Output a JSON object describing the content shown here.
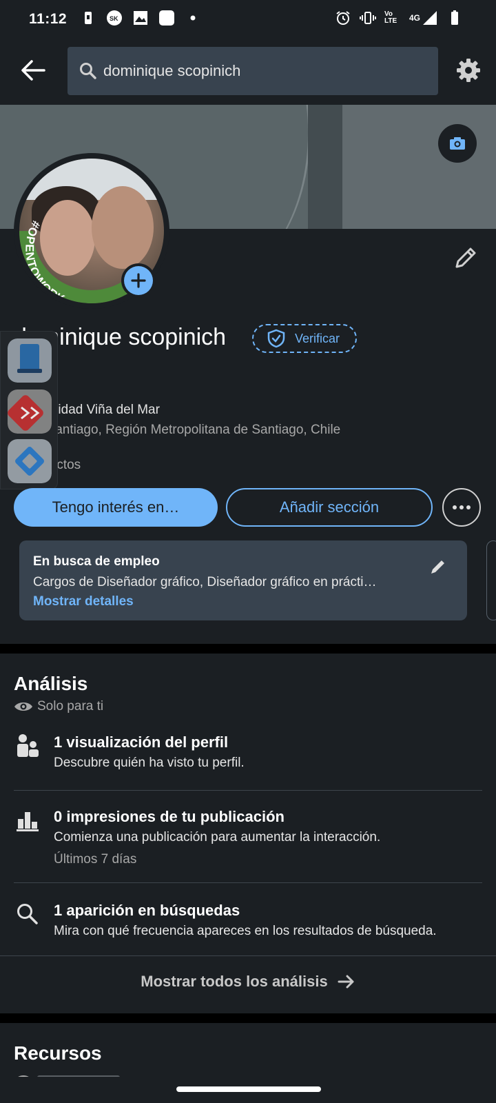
{
  "status_bar": {
    "time": "11:12",
    "network_label": "4G",
    "volte_label": "Vo LTE"
  },
  "search": {
    "query": "dominique scopinich"
  },
  "profile": {
    "name": "dominique scopinich",
    "verify_label": "Verificar",
    "open_to_work_badge": "#OPENTOWORK",
    "university": "Universidad Viña del Mar",
    "location": "Gran Santiago, Región Metropolitana de Santiago, Chile",
    "contacts": "0 contactos"
  },
  "actions": {
    "primary": "Tengo interés en…",
    "secondary": "Añadir sección"
  },
  "job_search": {
    "title": "En busca de empleo",
    "description": "Cargos de Diseñador gráfico, Diseñador gráfico en prácti…",
    "link": "Mostrar detalles"
  },
  "analytics": {
    "title": "Análisis",
    "privacy": "Solo para ti",
    "items": [
      {
        "icon": "people-icon",
        "title": "1 visualización del perfil",
        "subtitle": "Descubre quién ha visto tu perfil."
      },
      {
        "icon": "bar-chart-icon",
        "title": "0 impresiones de tu publicación",
        "subtitle": "Comienza una publicación para aumentar la interacción.",
        "meta": "Últimos 7 días"
      },
      {
        "icon": "search-icon",
        "title": "1 aparición en búsquedas",
        "subtitle": "Mira con qué frecuencia apareces en los resultados de búsqueda."
      }
    ],
    "show_all": "Mostrar todos los análisis"
  },
  "resources": {
    "title": "Recursos"
  },
  "colors": {
    "accent": "#70b5f9",
    "background": "#1b1f23",
    "card": "#38434f"
  }
}
